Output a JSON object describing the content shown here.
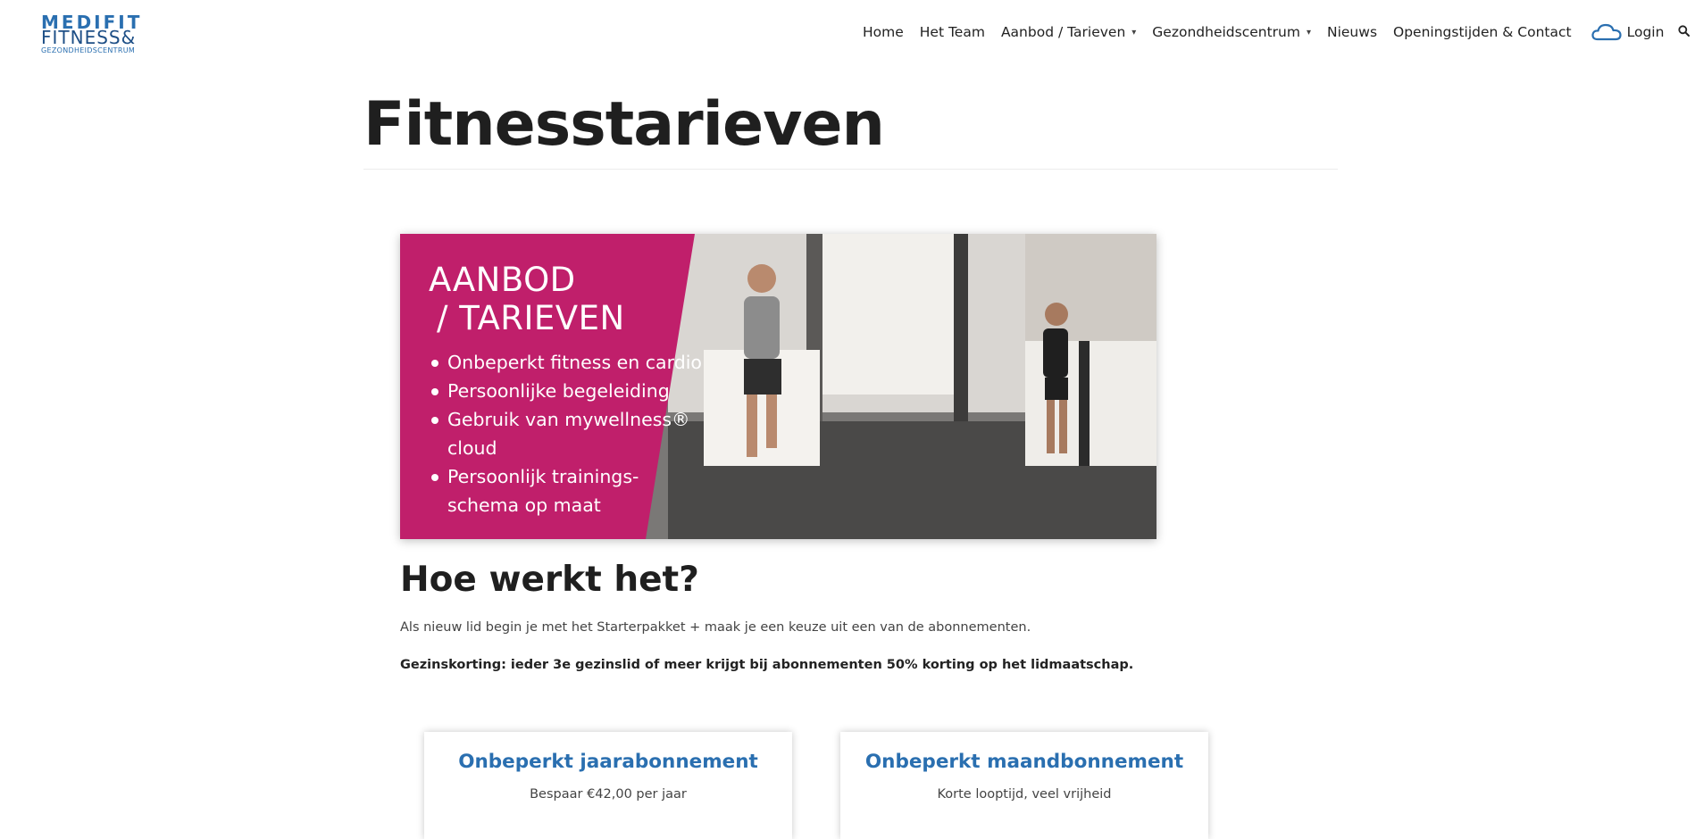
{
  "brand": {
    "line1": "MEDIFIT",
    "line2": "FITNESS&",
    "line3": "GEZONDHEIDSCENTRUM",
    "primary_color": "#2a6fb0",
    "banner_color": "#c01f6b"
  },
  "nav": {
    "items": [
      {
        "label": "Home"
      },
      {
        "label": "Het Team"
      },
      {
        "label": "Aanbod / Tarieven"
      },
      {
        "label": "Gezondheidscentrum"
      },
      {
        "label": "Nieuws"
      },
      {
        "label": "Openingstijden & Contact"
      }
    ],
    "login_label": "Login",
    "login_icon": "cloud-icon",
    "search_icon": "search-icon",
    "dropdown_icon": "chevron-down-icon"
  },
  "page": {
    "title": "Fitnesstarieven"
  },
  "banner": {
    "heading_line1": "AANBOD",
    "heading_line2": "/ TARIEVEN",
    "bullets": [
      "Onbeperkt fitness en cardio",
      "Persoonlijke begeleiding",
      "Gebruik van mywellness®",
      "cloud",
      "Persoonlijk trainings-",
      "schema op maat"
    ]
  },
  "content": {
    "heading": "Hoe werkt het?",
    "intro": "Als nieuw lid begin je met het Starterpakket + maak je een keuze uit een van de abonnementen.",
    "discount": "Gezinskorting: ieder 3e gezinslid of meer krijgt bij abonnementen 50% korting op het lidmaatschap."
  },
  "plans": [
    {
      "title": "Onbeperkt jaarabonnement",
      "subtitle": "Bespaar €42,00 per jaar"
    },
    {
      "title": "Onbeperkt maandbonnement",
      "subtitle": "Korte looptijd, veel vrijheid"
    }
  ]
}
